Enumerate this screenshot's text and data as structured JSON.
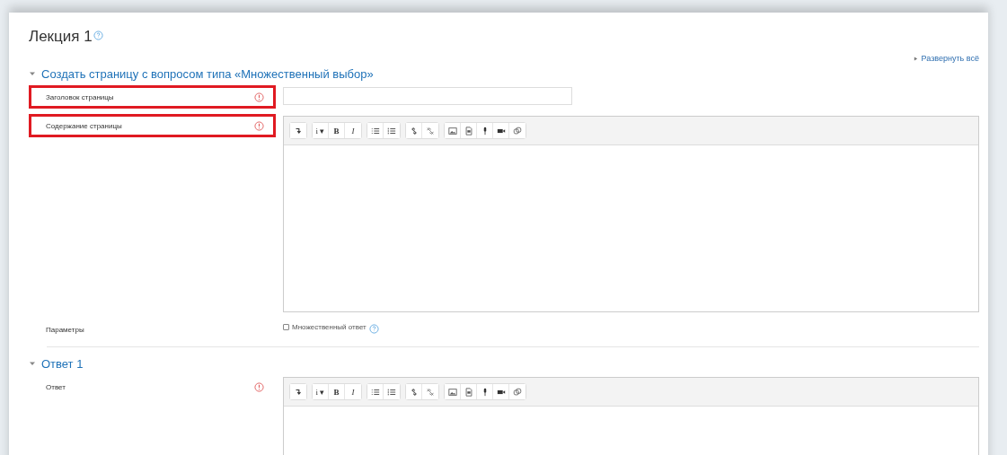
{
  "title": "Лекция 1",
  "expand_all": "Развернуть всё",
  "sections": [
    {
      "title": "Создать страницу с вопросом типа «Множественный выбор»",
      "expanded": true,
      "fields": [
        {
          "kind": "text",
          "label": "Заголовок страницы",
          "required": true,
          "highlighted": true
        },
        {
          "kind": "editor",
          "label": "Содержание страницы",
          "required": true,
          "highlighted": true,
          "toolbar": [
            [
              {
                "kind": "collapse"
              }
            ],
            [
              {
                "kind": "text",
                "label": "i ▾"
              },
              {
                "kind": "bold",
                "label": "B"
              },
              {
                "kind": "italic",
                "label": "I"
              }
            ],
            [
              {
                "kind": "ul"
              },
              {
                "kind": "ol"
              }
            ],
            [
              {
                "kind": "link"
              },
              {
                "kind": "unlink"
              }
            ],
            [
              {
                "kind": "image"
              },
              {
                "kind": "file"
              },
              {
                "kind": "mic"
              },
              {
                "kind": "video"
              },
              {
                "kind": "copy"
              }
            ]
          ]
        },
        {
          "kind": "checkbox",
          "label": "Параметры",
          "option": "Множественный ответ",
          "checked": false
        }
      ]
    },
    {
      "title": "Ответ 1",
      "expanded": true,
      "fields": [
        {
          "kind": "editor",
          "label": "Ответ",
          "required": true,
          "highlighted": false,
          "toolbar": [
            [
              {
                "kind": "collapse"
              }
            ],
            [
              {
                "kind": "text",
                "label": "i ▾"
              },
              {
                "kind": "bold",
                "label": "B"
              },
              {
                "kind": "italic",
                "label": "I"
              }
            ],
            [
              {
                "kind": "ul"
              },
              {
                "kind": "ol"
              }
            ],
            [
              {
                "kind": "link"
              },
              {
                "kind": "unlink"
              }
            ],
            [
              {
                "kind": "image"
              },
              {
                "kind": "file"
              },
              {
                "kind": "mic"
              },
              {
                "kind": "video"
              },
              {
                "kind": "copy"
              }
            ]
          ]
        }
      ]
    }
  ]
}
